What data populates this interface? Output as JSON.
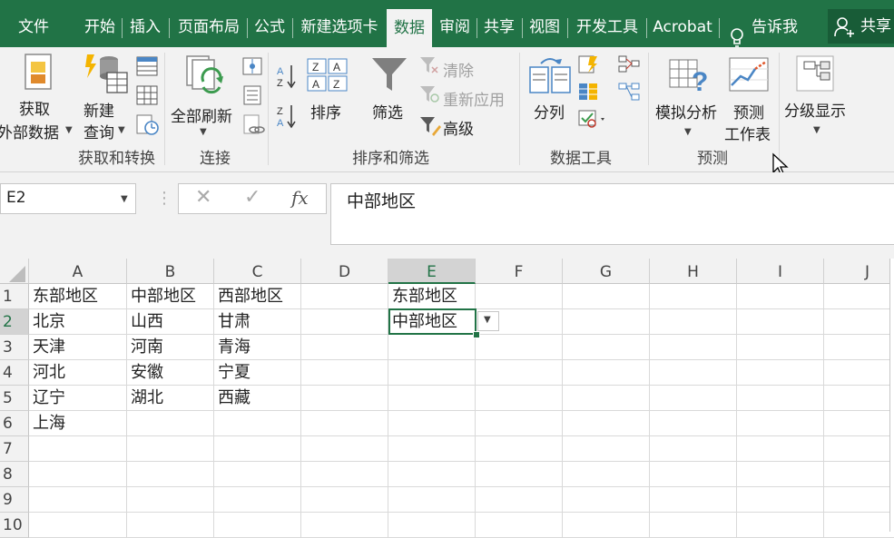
{
  "menu": {
    "tabs": [
      "文件",
      "开始",
      "插入",
      "页面布局",
      "公式",
      "新建选项卡",
      "数据",
      "审阅",
      "共享",
      "视图",
      "开发工具",
      "Acrobat"
    ],
    "active_tab": "数据",
    "tell_me": "告诉我",
    "share": "共享"
  },
  "ribbon": {
    "get_external_line1": "获取",
    "get_external_line2": "外部数据",
    "new_query_line1": "新建",
    "new_query_line2": "查询",
    "group_get_transform": "获取和转换",
    "refresh_all": "全部刷新",
    "group_connections": "连接",
    "sort": "排序",
    "filter": "筛选",
    "clear": "清除",
    "reapply": "重新应用",
    "advanced": "高级",
    "group_sort_filter": "排序和筛选",
    "text_to_columns": "分列",
    "group_data_tools": "数据工具",
    "what_if": "模拟分析",
    "forecast_line1": "预测",
    "forecast_line2": "工作表",
    "group_forecast": "预测",
    "outline": "分级显示"
  },
  "formula_bar": {
    "name_box": "E2",
    "fx": "fx",
    "content": "中部地区"
  },
  "sheet": {
    "columns": [
      "A",
      "B",
      "C",
      "D",
      "E",
      "F",
      "G",
      "H",
      "I",
      "J"
    ],
    "rows": [
      "1",
      "2",
      "3",
      "4",
      "5",
      "6",
      "7",
      "8",
      "9",
      "10"
    ],
    "cells": {
      "A1": "东部地区",
      "B1": "中部地区",
      "C1": "西部地区",
      "E1": "东部地区",
      "A2": "北京",
      "B2": "山西",
      "C2": "甘肃",
      "E2": "中部地区",
      "A3": "天津",
      "B3": "河南",
      "C3": "青海",
      "A4": "河北",
      "B4": "安徽",
      "C4": "宁夏",
      "A5": "辽宁",
      "B5": "湖北",
      "C5": "西藏",
      "A6": "上海"
    },
    "selected_cell": "E2"
  }
}
